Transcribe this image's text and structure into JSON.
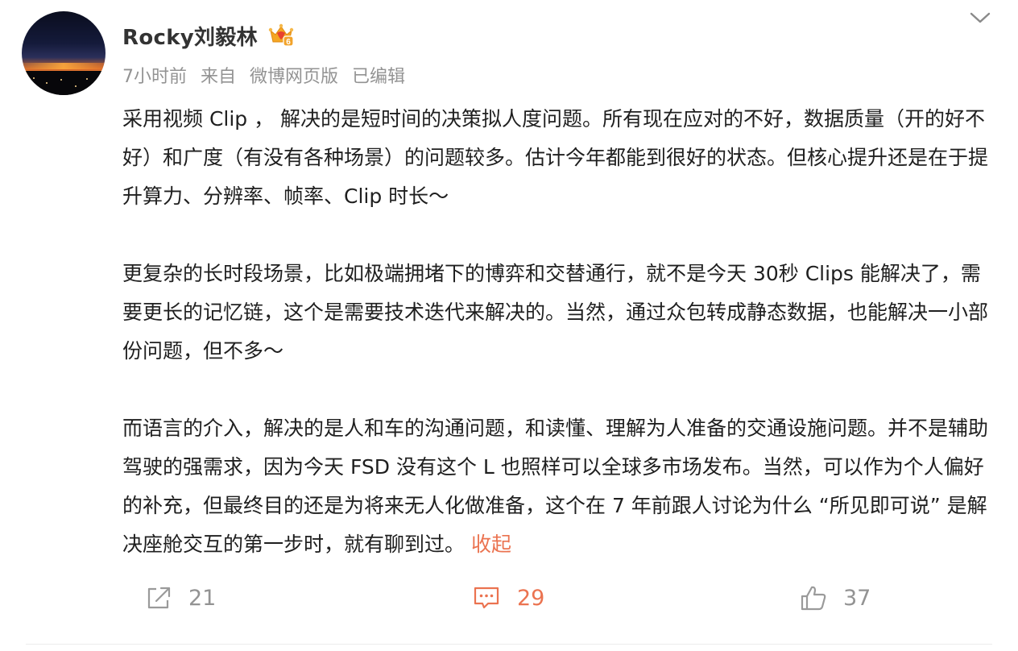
{
  "post": {
    "author": {
      "name": "Rocky刘毅林",
      "badge_icon": "vip-crown-level-6-icon"
    },
    "meta": {
      "time": "7小时前",
      "source_prefix": "来自",
      "source": "微博网页版",
      "edited": "已编辑"
    },
    "content": {
      "paragraphs": [
        "采用视频 Clip ， 解决的是短时间的决策拟人度问题。所有现在应对的不好，数据质量（开的好不好）和广度（有没有各种场景）的问题较多。估计今年都能到很好的状态。但核心提升还是在于提升算力、分辨率、帧率、Clip 时长～",
        "更复杂的长时段场景，比如极端拥堵下的博弈和交替通行，就不是今天 30秒 Clips 能解决了，需要更长的记忆链，这个是需要技术迭代来解决的。当然，通过众包转成静态数据，也能解决一小部份问题，但不多～",
        "而语言的介入，解决的是人和车的沟通问题，和读懂、理解为人准备的交通设施问题。并不是辅助驾驶的强需求，因为今天 FSD 没有这个 L 也照样可以全球多市场发布。当然，可以作为个人偏好的补充，但最终目的还是为将来无人化做准备，这个在 7 年前跟人讨论为什么 “所见即可说” 是解决座舱交互的第一步时，就有聊到过。"
      ],
      "collapse_label": "收起"
    },
    "actions": {
      "share_count": "21",
      "comment_count": "29",
      "like_count": "37"
    },
    "colors": {
      "accent": "#eb7350",
      "meta_gray": "#939393",
      "text": "#1f1f1f"
    }
  }
}
